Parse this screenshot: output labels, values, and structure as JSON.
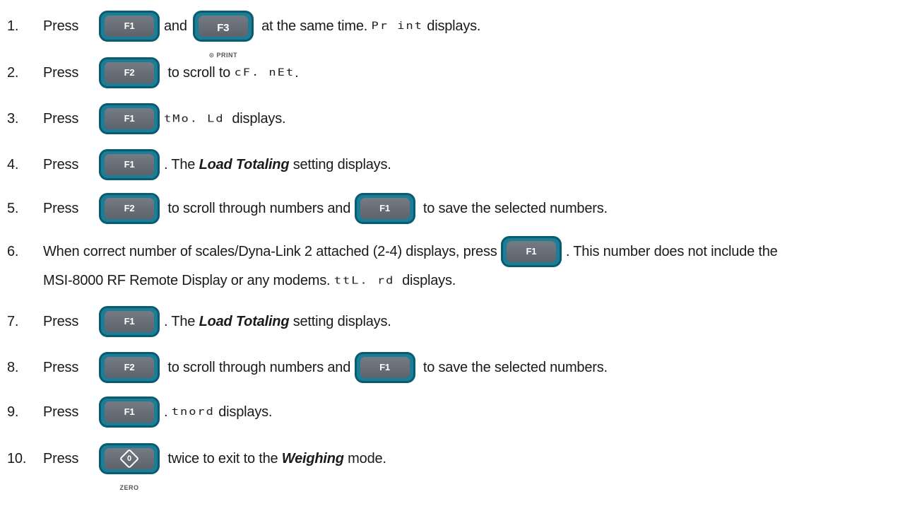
{
  "steps": [
    {
      "num": "1.",
      "press": "Press",
      "key1": "F1",
      "mid": "and",
      "key2": "F3",
      "key2_sub": "⊙ PRINT",
      "t1": " at the same time. ",
      "seg": "Pr int",
      "t2": " displays."
    },
    {
      "num": "2.",
      "press": "Press",
      "key": "F2",
      "t1": " to scroll to ",
      "seg": "cF. nEt",
      "t2": "."
    },
    {
      "num": "3.",
      "press": "Press",
      "key": "F1",
      "seg": "tMo. Ld",
      "t2": "  displays."
    },
    {
      "num": "4.",
      "press": "Press",
      "key": "F1",
      "t1": ". The ",
      "em": "Load Totaling",
      "t2": " setting displays."
    },
    {
      "num": "5.",
      "press": "Press",
      "key1": "F2",
      "t1": " to scroll through numbers and ",
      "key2": "F1",
      "t2": " to save the selected numbers."
    },
    {
      "num": "6.",
      "t1": "When correct number of scales/Dyna-Link 2 attached (2-4) displays, press ",
      "key": "F1",
      "t2": ". This number does not include the",
      "line2": "MSI-8000 RF Remote Display or any modems. ",
      "seg": "ttL. rd",
      "line2b": "  displays."
    },
    {
      "num": "7.",
      "press": "Press",
      "key": "F1",
      "t1": ". The ",
      "em": "Load Totaling",
      "t2": " setting displays."
    },
    {
      "num": "8.",
      "press": "Press",
      "key1": "F2",
      "t1": " to scroll through numbers and ",
      "key2": "F1",
      "t2": " to save the selected numbers."
    },
    {
      "num": "9.",
      "press": "Press",
      "key": "F1",
      "t1": ". ",
      "seg": "tnord",
      "t2": " displays."
    },
    {
      "num": "10.",
      "press": "Press",
      "key_icon": "zero-icon",
      "key_sub": "ZERO",
      "t1": " twice to exit to the ",
      "em": "Weighing",
      "t2": " mode."
    }
  ]
}
